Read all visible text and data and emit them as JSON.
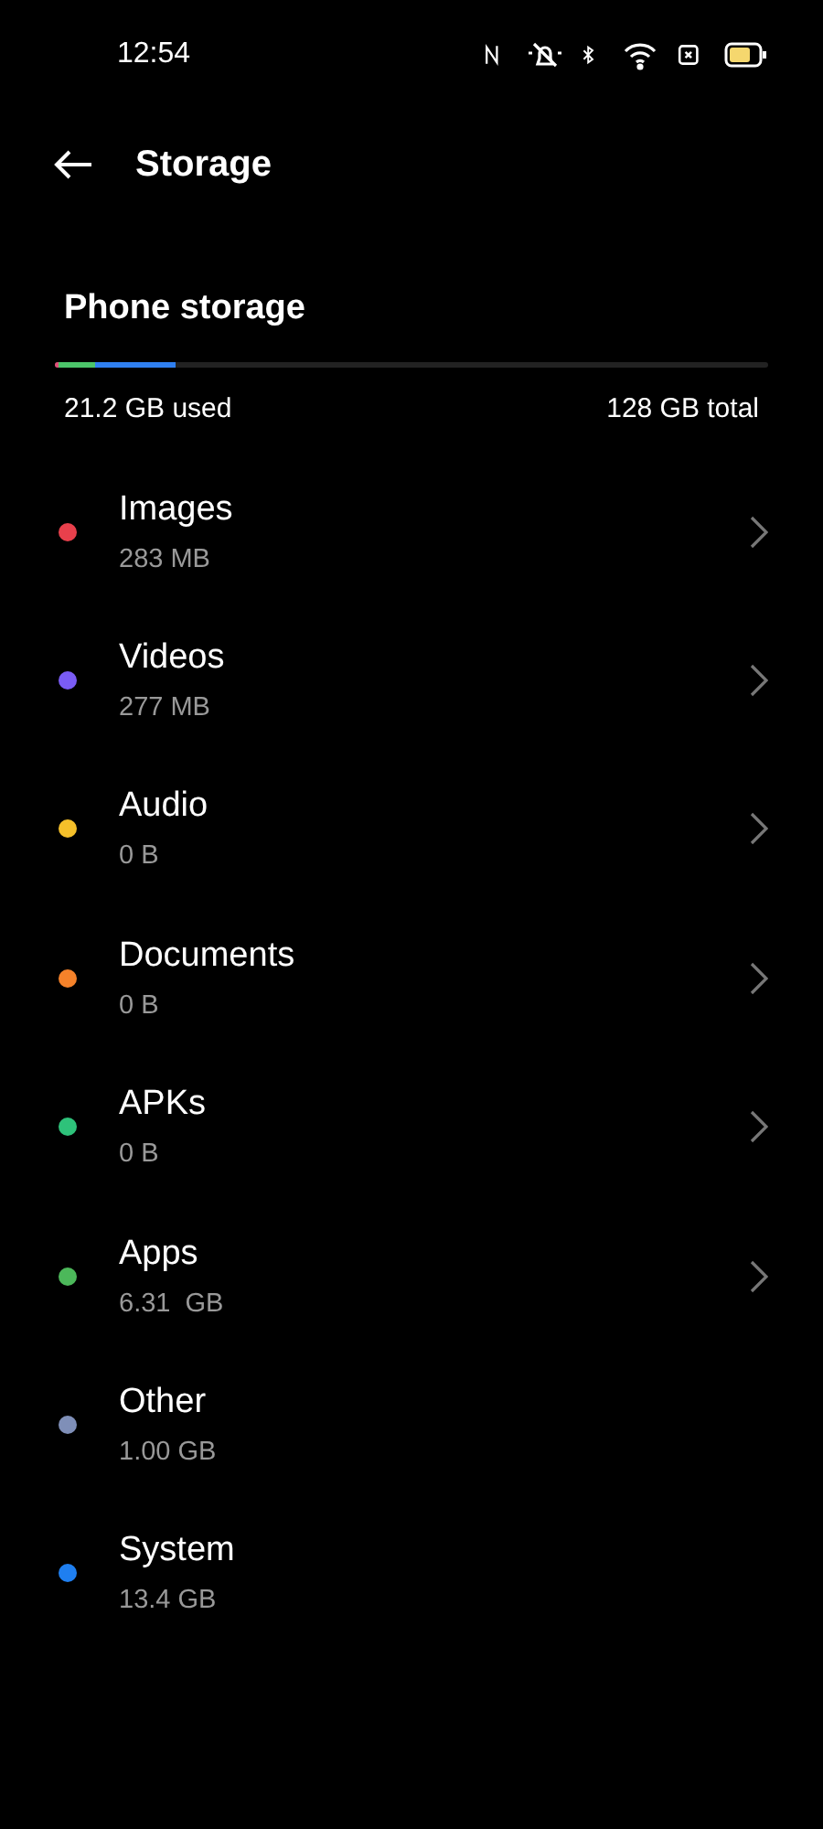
{
  "status_bar": {
    "time": "12:54"
  },
  "header": {
    "title": "Storage"
  },
  "storage": {
    "title": "Phone storage",
    "used": "21.2 GB used",
    "total": "128 GB total",
    "segments": [
      {
        "color": "#e0507a",
        "level": 0.006
      },
      {
        "color": "#4cc46a",
        "level": 0.05
      },
      {
        "color": "#2f7ff0",
        "level": 0.112
      }
    ]
  },
  "categories": [
    {
      "name": "Images",
      "size": "283 MB",
      "color": "#e8404c",
      "chevron": true
    },
    {
      "name": "Videos",
      "size": "277 MB",
      "color": "#7a5cf5",
      "chevron": true
    },
    {
      "name": "Audio",
      "size": "0 B",
      "color": "#f5c02a",
      "chevron": true
    },
    {
      "name": "Documents",
      "size": "0 B",
      "color": "#f5822a",
      "chevron": true
    },
    {
      "name": "APKs",
      "size": "0 B",
      "color": "#2ec27a",
      "chevron": true
    },
    {
      "name": "Apps",
      "size": "6.31  GB",
      "color": "#4cb85a",
      "chevron": true
    },
    {
      "name": "Other",
      "size": "1.00 GB",
      "color": "#7f8fb8",
      "chevron": false
    },
    {
      "name": "System",
      "size": "13.4 GB",
      "color": "#1f7ff0",
      "chevron": false
    }
  ]
}
